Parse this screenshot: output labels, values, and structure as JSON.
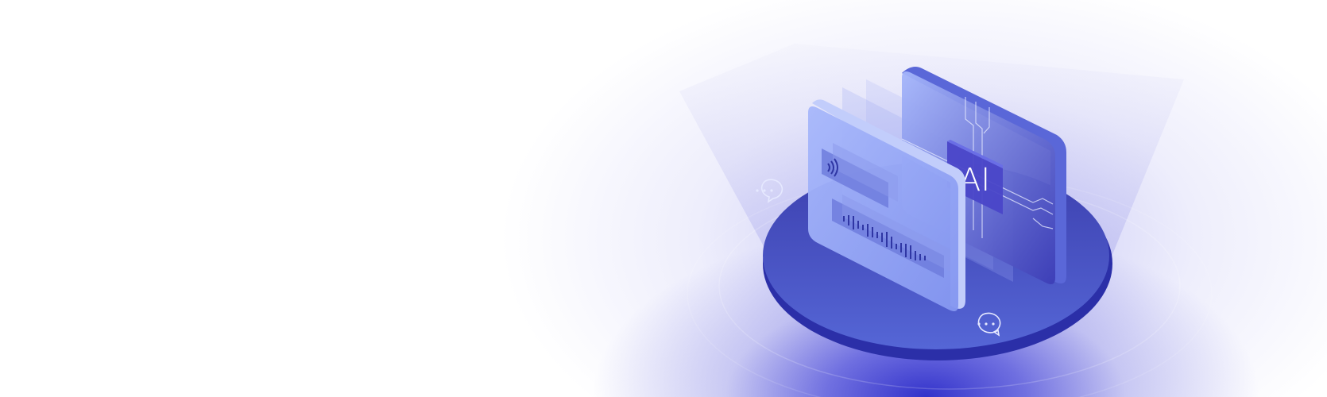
{
  "hero": {
    "ai_label": "AI",
    "colors": {
      "accent_deep": "#2f2fb8",
      "accent": "#4b57cc",
      "panel_light": "#9fb0f7",
      "panel_dark": "#3b3fb3",
      "tag": "#5b5ad8"
    },
    "icons": [
      "chat-bubble-icon",
      "sound-wave-icon",
      "audio-waveform-icon"
    ]
  }
}
